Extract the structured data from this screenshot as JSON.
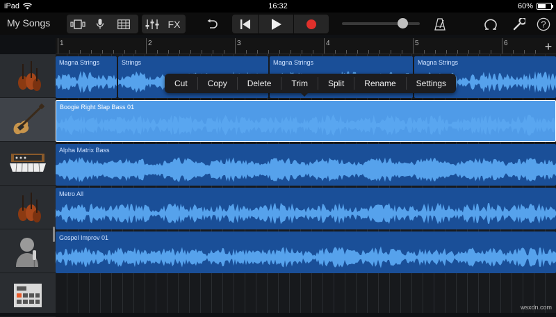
{
  "status_bar": {
    "device": "iPad",
    "time": "16:32",
    "battery_pct": "60%",
    "battery_level": 0.6,
    "icons": [
      "wifi-icon",
      "battery-icon"
    ]
  },
  "toolbar": {
    "title": "My Songs",
    "fx_label": "FX",
    "icons": [
      "browser-icon",
      "microphone-icon",
      "grid-view-icon",
      "mixer-icon",
      "undo-icon",
      "rewind-icon",
      "play-icon",
      "record-icon",
      "metronome-icon",
      "loop-icon",
      "settings-wrench-icon",
      "help-icon"
    ],
    "record_color": "#e0302b",
    "volume_level": 0.78
  },
  "ruler": {
    "bars": [
      "1",
      "2",
      "3",
      "4",
      "5",
      "6"
    ],
    "add_label": "+"
  },
  "tracks": [
    {
      "instrument": "strings-icon",
      "selected": false,
      "regions": [
        "Magna Strings",
        "Strings",
        "Magna Strings",
        "Magna Strings"
      ]
    },
    {
      "instrument": "bass-guitar-icon",
      "selected": true,
      "regions": [
        "Boogie Right Slap Bass 01"
      ]
    },
    {
      "instrument": "synth-keyboard-icon",
      "selected": false,
      "regions": [
        "Alpha Matrix Bass"
      ]
    },
    {
      "instrument": "strings-icon",
      "selected": false,
      "regions": [
        "Metro All"
      ]
    },
    {
      "instrument": "microphone-vocal-icon",
      "selected": false,
      "regions": [
        "Gospel Improv 01"
      ]
    },
    {
      "instrument": "drum-machine-icon",
      "selected": false,
      "regions": []
    }
  ],
  "context_menu": {
    "items": [
      "Cut",
      "Copy",
      "Delete",
      "Trim",
      "Split",
      "Rename",
      "Settings"
    ]
  },
  "colors": {
    "region": "#1a4f98",
    "region_selected": "#4f9be8",
    "wave": "#5aa7f0"
  },
  "watermark": "wsxdn.com"
}
